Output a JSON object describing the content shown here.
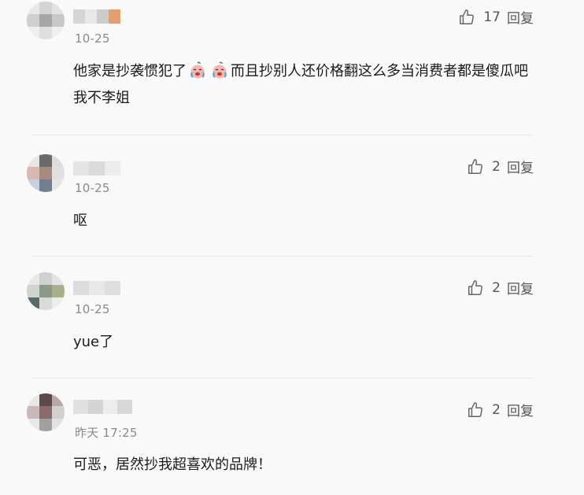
{
  "comments": [
    {
      "time": "10-25",
      "likes": "17",
      "reply_label": "回复",
      "text_before": "他家是抄袭惯犯了",
      "text_after": "而且抄别人还价格翻这么多当消费者都是傻瓜吧 我不李姐",
      "emoji_icon": "crying-face-emoji"
    },
    {
      "time": "10-25",
      "likes": "2",
      "reply_label": "回复",
      "text": "呕"
    },
    {
      "time": "10-25",
      "likes": "2",
      "reply_label": "回复",
      "text": "yue了"
    },
    {
      "time": "昨天 17:25",
      "likes": "2",
      "reply_label": "回复",
      "text": "可恶，居然抄我超喜欢的品牌！"
    }
  ]
}
